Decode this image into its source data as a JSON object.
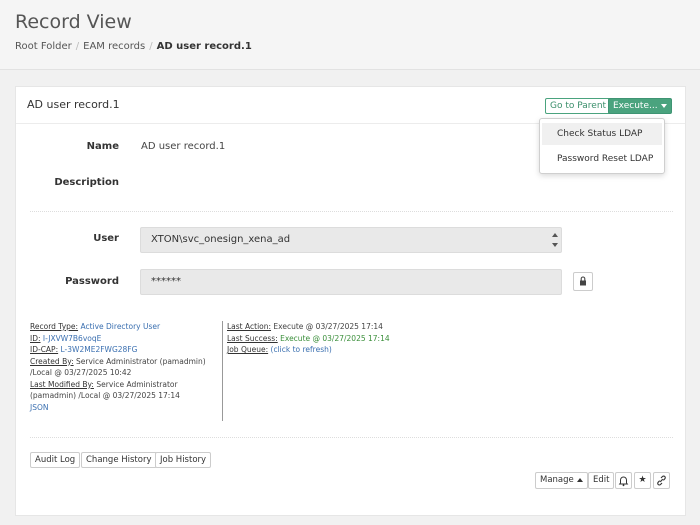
{
  "header": {
    "title": "Record View",
    "breadcrumb": {
      "root": "Root Folder",
      "parent": "EAM records",
      "current": "AD user record.1"
    }
  },
  "card": {
    "title": "AD user record.1",
    "go_to_parent_label": "Go to Parent",
    "execute_label": "Execute...",
    "execute_menu": {
      "items": [
        {
          "label": "Check Status LDAP"
        },
        {
          "label": "Password Reset LDAP"
        }
      ]
    }
  },
  "fields": {
    "name_label": "Name",
    "name_value": "AD user record.1",
    "description_label": "Description",
    "description_value": "",
    "user_label": "User",
    "user_value": "XTON\\svc_onesign_xena_ad",
    "password_label": "Password",
    "password_value": "******"
  },
  "meta": {
    "record_type_label": "Record Type:",
    "record_type_value": "Active Directory User",
    "id_label": "ID:",
    "id_value": "I-JXVW7B6voqE",
    "id_cap_label": "ID-CAP:",
    "id_cap_value": "L-3W2ME2FWG28FG",
    "created_by_label": "Created By:",
    "created_by_value": "Service Administrator (pamadmin)",
    "created_by_line2": "/Local @ 03/27/2025 10:42",
    "modified_by_label": "Last Modified By:",
    "modified_by_value": "Service Administrator",
    "modified_by_line2": "(pamadmin) /Local @ 03/27/2025 17:14",
    "json_label": "JSON",
    "last_action_label": "Last Action:",
    "last_action_value": "Execute @ 03/27/2025 17:14",
    "last_success_label": "Last Success:",
    "last_success_value": "Execute @ 03/27/2025 17:14",
    "job_queue_label": "Job Queue:",
    "job_queue_value": "(click to refresh)"
  },
  "history_tabs": {
    "audit_log": "Audit Log",
    "change_history": "Change History",
    "job_history": "Job History"
  },
  "toolbar": {
    "manage_label": "Manage",
    "edit_label": "Edit",
    "bell_icon": "bell-icon",
    "star_icon": "star-icon",
    "link_icon": "link-icon"
  },
  "colors": {
    "accent_green": "#4aa37e",
    "link_blue": "#3a6fb0",
    "success_green": "#3b8f3b"
  }
}
